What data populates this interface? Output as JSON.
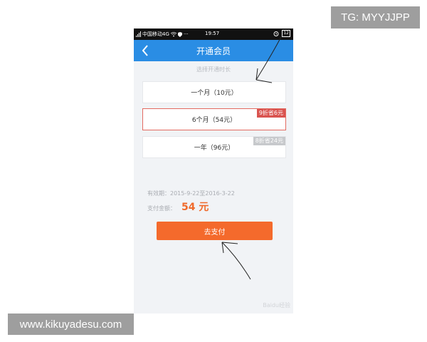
{
  "watermarks": {
    "top_right": "TG: MYYJJPP",
    "bottom_left": "www.kikuyadesu.com"
  },
  "status_bar": {
    "carrier": "中国移动4G",
    "time": "19:57",
    "battery": "12"
  },
  "nav": {
    "back_icon": "chevron-left-icon",
    "title": "开通会员"
  },
  "section_hint": "选择开通时长",
  "plans": [
    {
      "label": "一个月（10元）",
      "badge": "",
      "selected": false
    },
    {
      "label": "6个月（54元）",
      "badge": "9折省6元",
      "selected": true
    },
    {
      "label": "一年（96元）",
      "badge": "8折省24元",
      "selected": false
    }
  ],
  "validity": "有效期：2015-9-22至2016-3-22",
  "payment": {
    "label": "支付金额：",
    "amount": "54 元"
  },
  "pay_button": "去支付",
  "footer_mark": "Baidu经验",
  "colors": {
    "nav_blue": "#2a8de4",
    "accent_orange": "#f46a2c",
    "selected_red": "#d9534f"
  }
}
